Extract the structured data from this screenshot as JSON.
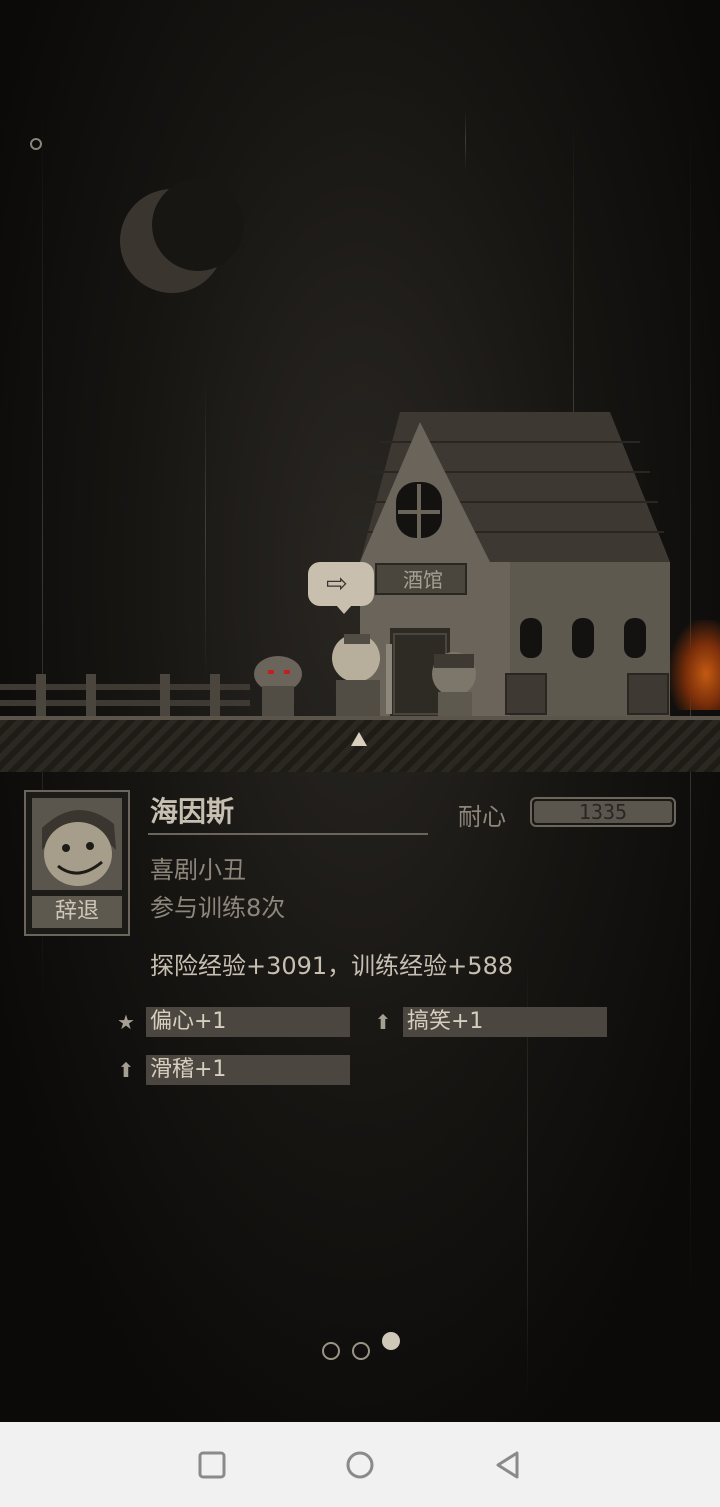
{
  "scene": {
    "tavern_sign": "酒馆"
  },
  "hero": {
    "name": "海因斯",
    "class": "喜剧小丑",
    "training_count_text": "参与训练8次",
    "dismiss_label": "辞退",
    "stat_label": "耐心",
    "stat_value": "1335",
    "exp_text": "探险经验+3091，训练经验+588"
  },
  "traits": [
    {
      "icon": "star-icon",
      "label": "偏心+1"
    },
    {
      "icon": "up-arrow-icon",
      "label": "搞笑+1"
    },
    {
      "icon": "up-arrow-icon",
      "label": "滑稽+1"
    }
  ],
  "pagination": {
    "total": 3,
    "active": 3
  },
  "colors": {
    "background": "#0b0a09",
    "panel_text": "#c7bfb1",
    "muted_text": "#8d867a",
    "trait_box": "#4b4740",
    "fire": "#c25a12",
    "navbar": "#f1f1f1"
  },
  "system_nav": {
    "buttons": [
      "recents-icon",
      "home-icon",
      "back-icon"
    ]
  }
}
